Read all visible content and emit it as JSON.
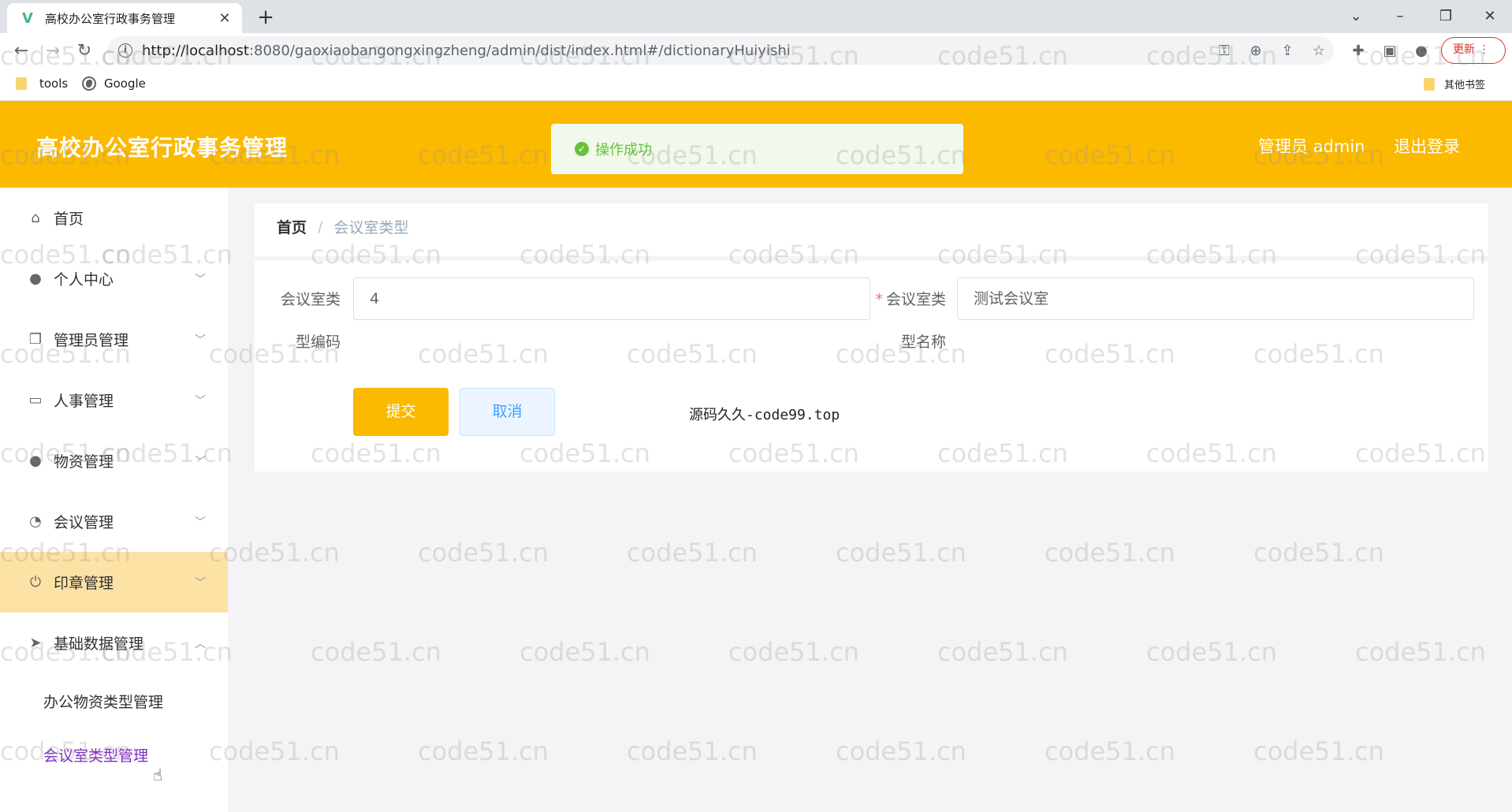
{
  "browser": {
    "tab_title": "高校办公室行政事务管理",
    "tab_favicon": "vue-icon",
    "url_host": "http://localhost",
    "url_rest": ":8080/gaoxiaobangongxingzheng/admin/dist/index.html#/dictionaryHuiyishi",
    "update_label": "更新",
    "bookmarks": [
      {
        "label": "tools",
        "icon": "folder-icon"
      },
      {
        "label": "Google",
        "icon": "globe-icon"
      }
    ],
    "other_bookmarks": "其他书签"
  },
  "header": {
    "title": "高校办公室行政事务管理",
    "admin_label": "管理员 admin",
    "logout_label": "退出登录"
  },
  "toast": {
    "message": "操作成功",
    "color": "#67c23a"
  },
  "sidebar": {
    "items": [
      {
        "label": "首页",
        "icon": "home-icon"
      },
      {
        "label": "个人中心",
        "icon": "user-icon"
      },
      {
        "label": "管理员管理",
        "icon": "copy-icon"
      },
      {
        "label": "人事管理",
        "icon": "chat-icon"
      },
      {
        "label": "物资管理",
        "icon": "users-icon"
      },
      {
        "label": "会议管理",
        "icon": "compass-icon"
      },
      {
        "label": "印章管理",
        "icon": "power-icon"
      },
      {
        "label": "基础数据管理",
        "icon": "send-icon"
      }
    ],
    "sub_items": [
      {
        "label": "办公物资类型管理"
      },
      {
        "label": "会议室类型管理"
      }
    ]
  },
  "breadcrumb": {
    "home": "首页",
    "separator": "/",
    "current": "会议室类型"
  },
  "form": {
    "code_label_line1": "会议室类",
    "code_label_line2": "型编码",
    "code_value": "4",
    "name_required_mark": "*",
    "name_label_line1": "会议室类",
    "name_label_line2": "型名称",
    "name_value": "测试会议室",
    "submit_label": "提交",
    "cancel_label": "取消"
  },
  "footer_note": "源码久久-code99.top",
  "watermark_text": "code51.cn",
  "colors": {
    "brand": "#fbb900",
    "active_menu": "#fde2a5",
    "current_sub": "#7b2cbf"
  }
}
